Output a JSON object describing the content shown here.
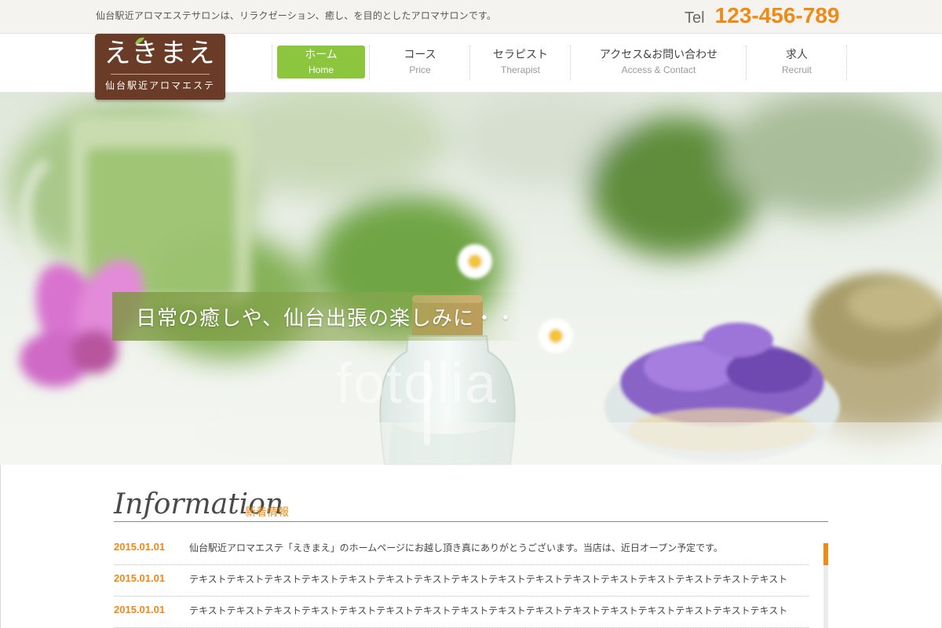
{
  "topbar": {
    "tagline": "仙台駅近アロマエステサロンは、リラクゼーション、癒し、を目的としたアロマサロンです。",
    "tel_label": "Tel",
    "tel_number": "123-456-789"
  },
  "logo": {
    "main": "えきまえ",
    "sub": "仙台駅近アロマエステ",
    "icon": "leaf-icon"
  },
  "nav": [
    {
      "jp": "ホーム",
      "en": "Home",
      "active": true
    },
    {
      "jp": "コース",
      "en": "Price",
      "active": false
    },
    {
      "jp": "セラピスト",
      "en": "Therapist",
      "active": false
    },
    {
      "jp": "アクセス&お問い合わせ",
      "en": "Access & Contact",
      "active": false
    },
    {
      "jp": "求人",
      "en": "Recruit",
      "active": false
    }
  ],
  "hero": {
    "copy": "日常の癒しや、仙台出張の楽しみに・・",
    "watermark": "fotolia"
  },
  "information": {
    "title": "Information",
    "subtitle": "新着情報",
    "items": [
      {
        "date": "2015.01.01",
        "text": "仙台駅近アロマエステ「えきまえ」のホームページにお越し頂き真にありがとうございます。当店は、近日オープン予定です。"
      },
      {
        "date": "2015.01.01",
        "text": "テキストテキストテキストテキストテキストテキストテキストテキストテキストテキストテキストテキストテキストテキストテキストテキスト"
      },
      {
        "date": "2015.01.01",
        "text": "テキストテキストテキストテキストテキストテキストテキストテキストテキストテキストテキストテキストテキストテキストテキストテキスト"
      }
    ]
  },
  "colors": {
    "accent_orange": "#ef8a16",
    "nav_active_green": "#8cc63e",
    "logo_brown": "#6a3b26"
  }
}
